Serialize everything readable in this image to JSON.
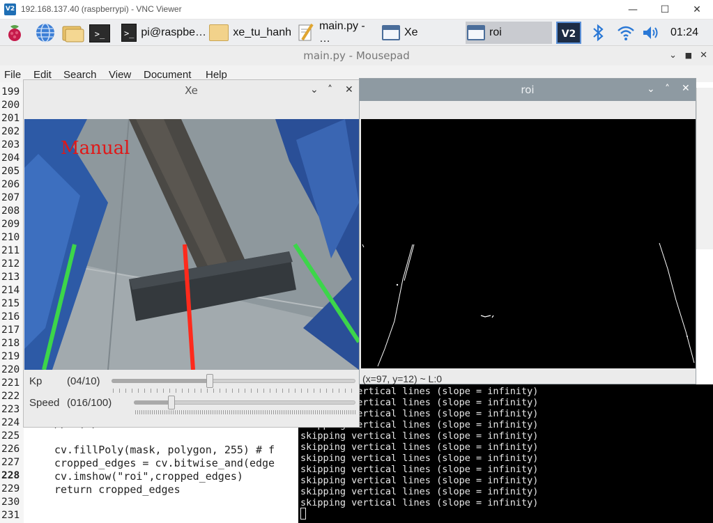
{
  "vnc": {
    "logo": "V2",
    "title": "192.168.137.40 (raspberrypi) - VNC Viewer",
    "minimize": "—",
    "maximize": "☐",
    "close": "✕"
  },
  "taskbar": {
    "tasks": [
      {
        "label": "pi@raspbe…",
        "icon": "terminal-icon"
      },
      {
        "label": "xe_tu_hanh",
        "icon": "folder-icon"
      },
      {
        "label": "main.py - …",
        "icon": "text-editor-icon"
      },
      {
        "label": "Xe",
        "icon": "window-icon"
      },
      {
        "label": "roi",
        "icon": "window-icon"
      }
    ],
    "vnc_tray": "V2",
    "clock": "01:24"
  },
  "mousepad": {
    "title": "main.py - Mousepad",
    "menu": [
      "File",
      "Edit",
      "Search",
      "View",
      "Document",
      "Help"
    ]
  },
  "editor": {
    "line_numbers": [
      "199",
      "200",
      "201",
      "202",
      "203",
      "204",
      "205",
      "206",
      "207",
      "208",
      "209",
      "210",
      "211",
      "212",
      "213",
      "214",
      "215",
      "216",
      "217",
      "218",
      "219",
      "220",
      "221",
      "222",
      "223",
      "224",
      "225",
      "226",
      "227",
      "228",
      "229",
      "230",
      "231"
    ],
    "current_line": "228",
    "code_lines": [
      {
        "line": "224",
        "text": "    ),  ( )"
      },
      {
        "line": "226",
        "text": "cv.fillPoly(mask, polygon, 255) # f"
      },
      {
        "line": "227",
        "text": "cropped_edges = cv.bitwise_and(edge"
      },
      {
        "line": "228",
        "text": "cv.imshow(\"roi\",cropped_edges)"
      },
      {
        "line": "229",
        "text": "return cropped_edges"
      }
    ]
  },
  "terminal": {
    "lines": [
      "skipping vertical lines (slope = infinity)",
      "skipping vertical lines (slope = infinity)",
      "skipping vertical lines (slope = infinity)",
      "skipping vertical lines (slope = infinity)",
      "skipping vertical lines (slope = infinity)",
      "skipping vertical lines (slope = infinity)",
      "skipping vertical lines (slope = infinity)",
      "skipping vertical lines (slope = infinity)",
      "skipping vertical lines (slope = infinity)",
      "skipping vertical lines (slope = infinity)",
      "skipping vertical lines (slope = infinity)"
    ]
  },
  "xe_window": {
    "title": "Xe",
    "overlay_text": "Manual",
    "kp": {
      "label": "Kp",
      "value_text": "(04/10)",
      "value": 4,
      "max": 10
    },
    "speed": {
      "label": "Speed",
      "value_text": "(016/100)",
      "value": 16,
      "max": 100
    },
    "line_colors": {
      "lane": "#3cd64a",
      "center": "#ff2a1c"
    }
  },
  "roi_window": {
    "title": "roi",
    "status": "(x=97, y=12) ~ L:0"
  }
}
